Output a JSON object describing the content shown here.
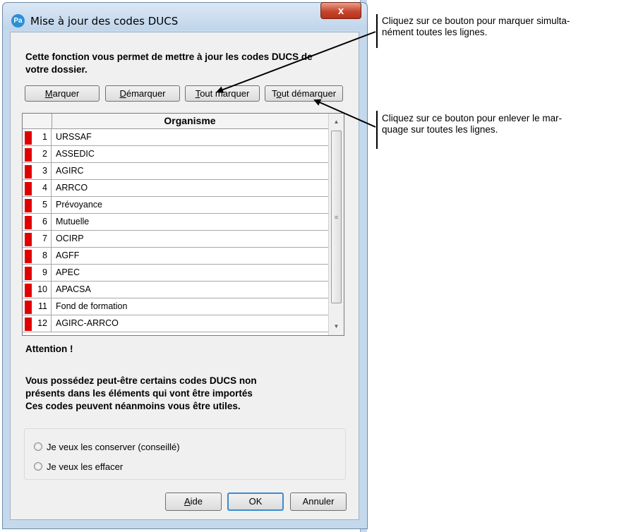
{
  "window": {
    "icon_text": "Pa",
    "title": "Mise à jour des codes DUCS",
    "close_label": "x"
  },
  "intro_text": "Cette fonction vous permet de mettre à jour les codes DUCS de votre dossier.",
  "toolbar": {
    "marquer_underlined": "M",
    "marquer_rest": "arquer",
    "demarquer_underlined": "D",
    "demarquer_rest": "émarquer",
    "tout_marquer_underlined": "T",
    "tout_marquer_rest": "out marquer",
    "tout_demarquer_prefix": "T",
    "tout_demarquer_underlined": "o",
    "tout_demarquer_rest": "ut démarquer"
  },
  "grid": {
    "column_header": "Organisme",
    "rows": [
      {
        "num": "1",
        "name": "URSSAF",
        "marked": true
      },
      {
        "num": "2",
        "name": "ASSEDIC",
        "marked": true
      },
      {
        "num": "3",
        "name": "AGIRC",
        "marked": true
      },
      {
        "num": "4",
        "name": "ARRCO",
        "marked": true
      },
      {
        "num": "5",
        "name": "Prévoyance",
        "marked": true
      },
      {
        "num": "6",
        "name": "Mutuelle",
        "marked": true
      },
      {
        "num": "7",
        "name": "OCIRP",
        "marked": true
      },
      {
        "num": "8",
        "name": "AGFF",
        "marked": true
      },
      {
        "num": "9",
        "name": "APEC",
        "marked": true
      },
      {
        "num": "10",
        "name": "APACSA",
        "marked": true
      },
      {
        "num": "11",
        "name": "Fond de formation",
        "marked": true
      },
      {
        "num": "12",
        "name": "AGIRC-ARRCO",
        "marked": true
      }
    ]
  },
  "attention_title": "Attention !",
  "warning_lines": [
    "Vous possédez peut-être certains codes DUCS non",
    "présents dans les éléments qui vont être importés",
    "Ces codes peuvent néanmoins vous être utiles."
  ],
  "options": [
    {
      "label": "Je veux les conserver (conseillé)",
      "selected": false
    },
    {
      "label": "Je veux les effacer",
      "selected": false
    }
  ],
  "footer": {
    "aide_underlined": "A",
    "aide_rest": "ide",
    "ok_label": "OK",
    "annuler_label": "Annuler"
  },
  "callouts": {
    "top_line1": "Cliquez sur ce bouton pour marquer simulta-",
    "top_line2": "nément toutes les lignes.",
    "bottom_line1": "Cliquez sur ce bouton pour enlever le mar-",
    "bottom_line2": "quage sur toutes les lignes."
  },
  "colors": {
    "mark_red": "#e10000",
    "accent_blue": "#3a8ccf",
    "close_red": "#c7452d"
  }
}
